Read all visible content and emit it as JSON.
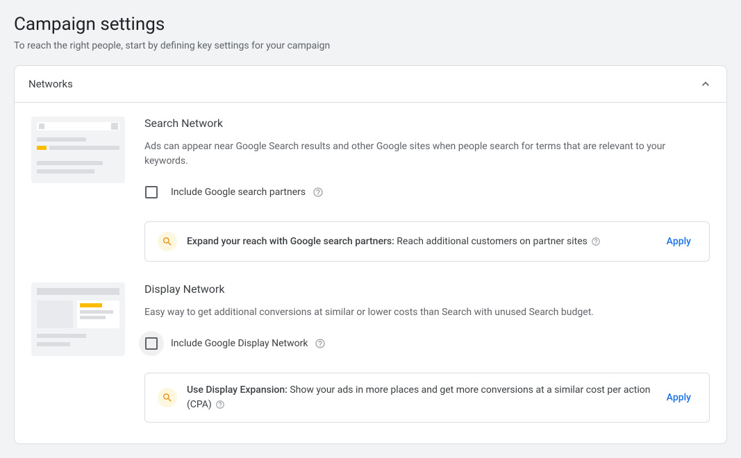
{
  "page": {
    "title": "Campaign settings",
    "subtitle": "To reach the right people, start by defining key settings for your campaign"
  },
  "card": {
    "title": "Networks"
  },
  "search_network": {
    "title": "Search Network",
    "description": "Ads can appear near Google Search results and other Google sites when people search for terms that are relevant to your keywords.",
    "checkbox_label": "Include Google search partners",
    "callout_bold": "Expand your reach with Google search partners:",
    "callout_text": " Reach additional customers on partner sites ",
    "apply": "Apply"
  },
  "display_network": {
    "title": "Display Network",
    "description": "Easy way to get additional conversions at similar or lower costs than Search with unused Search budget.",
    "checkbox_label": "Include Google Display Network",
    "callout_bold": "Use Display Expansion:",
    "callout_text": " Show your ads in more places and get more conversions at a similar cost per action (CPA) ",
    "apply": "Apply"
  }
}
